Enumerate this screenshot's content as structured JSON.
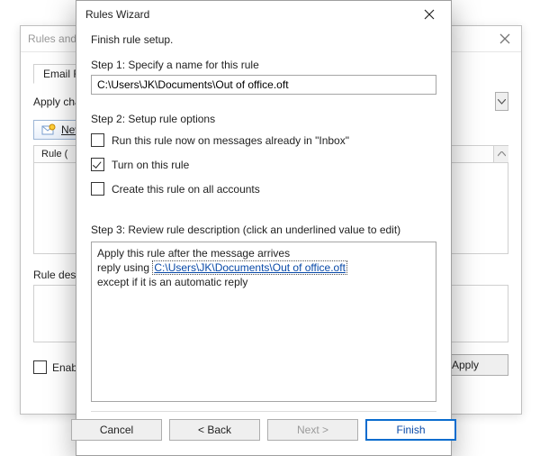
{
  "bg": {
    "title": "Rules and A",
    "tab_label": "Email Rule",
    "apply_label": "Apply cha",
    "new_rule_label": "New R",
    "list_header": "Rule (",
    "desc_label": "Rule desc",
    "enable_label": "Enable",
    "apply_btn": "Apply"
  },
  "wizard": {
    "title": "Rules Wizard",
    "heading": "Finish rule setup.",
    "step1_label": "Step 1: Specify a name for this rule",
    "name_value": "C:\\Users\\JK\\Documents\\Out of office.oft",
    "step2_label": "Step 2: Setup rule options",
    "opt_run_now": "Run this rule now on messages already in \"Inbox\"",
    "opt_turn_on": "Turn on this rule",
    "opt_all_accounts": "Create this rule on all accounts",
    "step3_label": "Step 3: Review rule description (click an underlined value to edit)",
    "desc_line1": "Apply this rule after the message arrives",
    "desc_line2_prefix": "reply using ",
    "desc_line2_link": "C:\\Users\\JK\\Documents\\Out of office.oft",
    "desc_line3": "except if it is an automatic reply",
    "btn_cancel": "Cancel",
    "btn_back": "< Back",
    "btn_next": "Next >",
    "btn_finish": "Finish"
  }
}
